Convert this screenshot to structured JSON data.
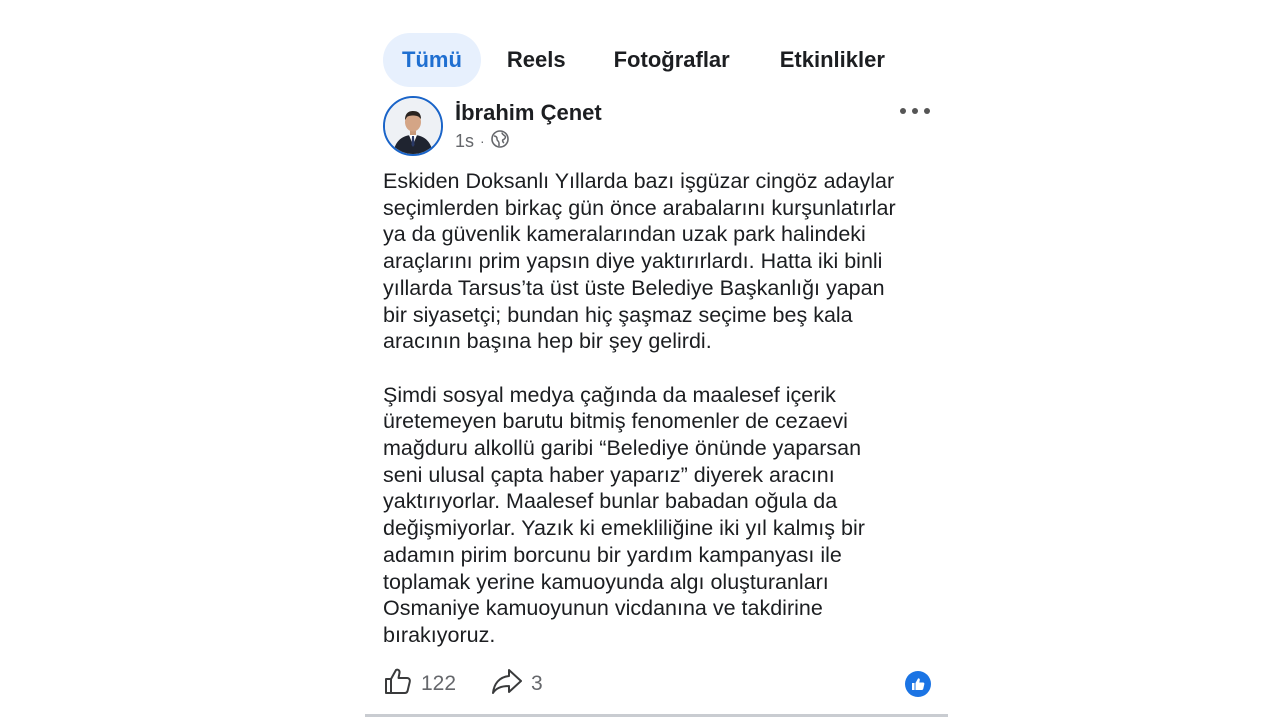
{
  "tabs": [
    {
      "label": "Tümü",
      "active": true
    },
    {
      "label": "Reels",
      "active": false
    },
    {
      "label": "Fotoğraflar",
      "active": false
    },
    {
      "label": "Etkinlikler",
      "active": false
    }
  ],
  "post": {
    "author": "İbrahim Çenet",
    "time": "1s",
    "separator": "·",
    "audience_icon": "globe-icon",
    "menu_icon": "more-options-icon",
    "paragraph1_lines": [
      "Eskiden Doksanlı Yıllarda bazı işgüzar cingöz adaylar",
      "seçimlerden birkaç gün önce arabalarını kurşunlatırlar",
      "ya da güvenlik kameralarından uzak park halindeki",
      "araçlarını prim yapsın diye yaktırırlardı. Hatta iki binli",
      "yıllarda Tarsus’ta üst üste Belediye Başkanlığı yapan",
      "bir siyasetçi; bundan hiç şaşmaz seçime beş kala",
      "aracının başına hep bir şey gelirdi."
    ],
    "paragraph2_lines": [
      "Şimdi sosyal medya çağında da maalesef içerik",
      "üretemeyen barutu bitmiş fenomenler de cezaevi",
      "mağduru alkollü garibi “Belediye önünde yaparsan",
      "seni ulusal çapta haber yaparız” diyerek aracını",
      "yaktırıyorlar.  Maalesef bunlar babadan oğula da",
      "değişmiyorlar. Yazık ki emekliliğine iki yıl kalmış bir",
      "adamın pirim borcunu bir yardım kampanyası ile",
      "toplamak  yerine kamuoyunda algı oluşturanları",
      "Osmaniye kamuoyunun vicdanına ve takdirine",
      "bırakıyoruz."
    ],
    "likes": "122",
    "shares": "3",
    "like_icon": "thumbs-up-icon",
    "share_icon": "share-arrow-icon",
    "reaction_icon": "like-reaction-icon"
  },
  "colors": {
    "accent": "#1f6fd1",
    "active_tab_bg": "#e7f0fd",
    "text": "#1c1e21",
    "muted": "#65676b",
    "reaction_blue": "#1b74e4"
  }
}
